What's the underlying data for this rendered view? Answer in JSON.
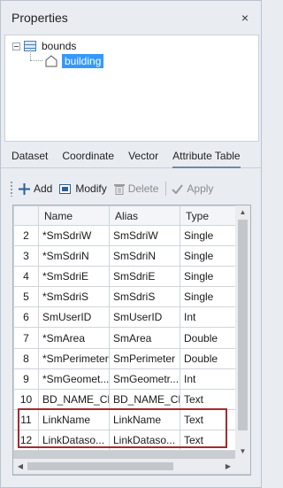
{
  "panel": {
    "title": "Properties",
    "close_icon": "×"
  },
  "tree": {
    "root_label": "bounds",
    "child_label": "building"
  },
  "tabs": [
    {
      "label": "Dataset"
    },
    {
      "label": "Coordinate"
    },
    {
      "label": "Vector"
    },
    {
      "label": "Attribute Table",
      "active": true
    }
  ],
  "toolbar": {
    "add_label": "Add",
    "modify_label": "Modify",
    "delete_label": "Delete",
    "apply_label": "Apply"
  },
  "table": {
    "headers": [
      "",
      "Name",
      "Alias",
      "Type"
    ],
    "rows": [
      {
        "num": "2",
        "name": "*SmSdriW",
        "alias": "SmSdriW",
        "type": "Single"
      },
      {
        "num": "3",
        "name": "*SmSdriN",
        "alias": "SmSdriN",
        "type": "Single"
      },
      {
        "num": "4",
        "name": "*SmSdriE",
        "alias": "SmSdriE",
        "type": "Single"
      },
      {
        "num": "5",
        "name": "*SmSdriS",
        "alias": "SmSdriS",
        "type": "Single"
      },
      {
        "num": "6",
        "name": "SmUserID",
        "alias": "SmUserID",
        "type": "Int"
      },
      {
        "num": "7",
        "name": "*SmArea",
        "alias": "SmArea",
        "type": "Double"
      },
      {
        "num": "8",
        "name": "*SmPerimeter",
        "alias": "SmPerimeter",
        "type": "Double"
      },
      {
        "num": "9",
        "name": "*SmGeomet...",
        "alias": "SmGeometr...",
        "type": "Int"
      },
      {
        "num": "10",
        "name": "BD_NAME_CH",
        "alias": "BD_NAME_CH",
        "type": "Text"
      },
      {
        "num": "11",
        "name": "LinkName",
        "alias": "LinkName",
        "type": "Text"
      },
      {
        "num": "12",
        "name": "LinkDataso...",
        "alias": "LinkDataso...",
        "type": "Text"
      }
    ]
  },
  "colors": {
    "panel_bg": "#e9edf2",
    "selection": "#3399ff",
    "highlight_border": "#a62a2a"
  }
}
